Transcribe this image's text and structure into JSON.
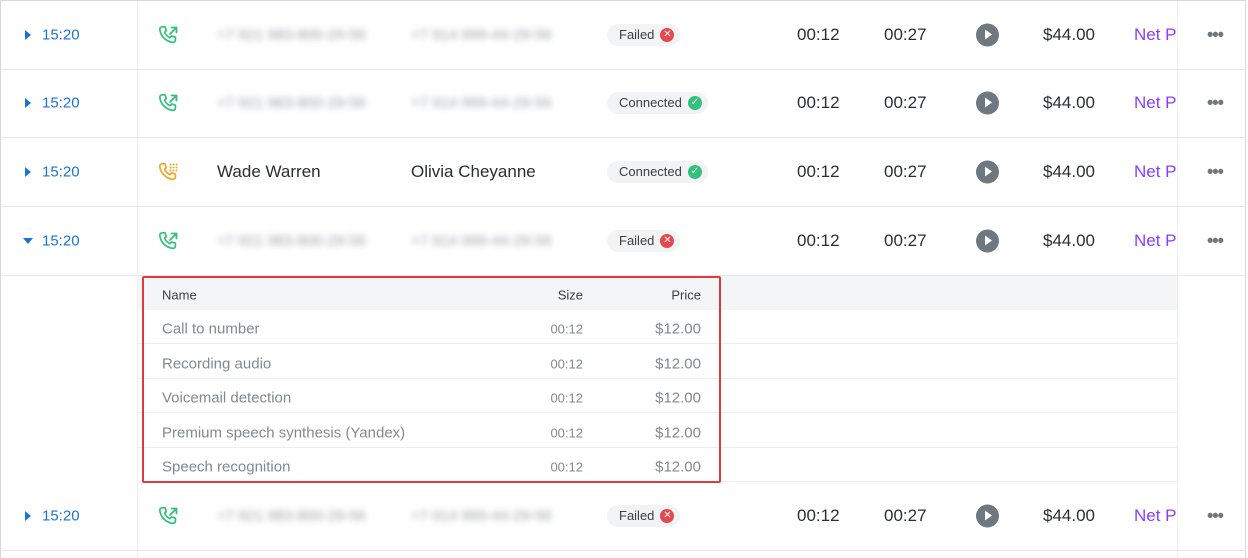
{
  "rows": [
    {
      "time": "15:20",
      "from": "+7 921 983-800-29-56",
      "to": "+7 914 999-44-29-56",
      "status": "Failed",
      "duration": "00:12",
      "billed": "00:27",
      "price": "$44.00",
      "tariff": "Net P",
      "expanded": false
    },
    {
      "time": "15:20",
      "from": "+7 921 983-800-29-56",
      "to": "+7 914 999-44-29-56",
      "status": "Connected",
      "duration": "00:12",
      "billed": "00:27",
      "price": "$44.00",
      "tariff": "Net P",
      "expanded": false
    },
    {
      "time": "15:20",
      "from": "Wade Warren",
      "to": "Olivia Cheyanne",
      "status": "Connected",
      "duration": "00:12",
      "billed": "00:27",
      "price": "$44.00",
      "tariff": "Net P",
      "expanded": false
    },
    {
      "time": "15:20",
      "from": "+7 921 983-800-29-56",
      "to": "+7 914 999-44-29-56",
      "status": "Failed",
      "duration": "00:12",
      "billed": "00:27",
      "price": "$44.00",
      "tariff": "Net P",
      "expanded": true
    },
    {
      "time": "15:20",
      "from": "+7 921 983-800-29-56",
      "to": "+7 914 999-44-29-56",
      "status": "Failed",
      "duration": "00:12",
      "billed": "00:27",
      "price": "$44.00",
      "tariff": "Net P",
      "expanded": false
    }
  ],
  "details": {
    "headers": {
      "name": "Name",
      "size": "Size",
      "price": "Price"
    },
    "items": [
      {
        "name": "Call to number",
        "size": "00:12",
        "price": "$12.00"
      },
      {
        "name": "Recording audio",
        "size": "00:12",
        "price": "$12.00"
      },
      {
        "name": "Voicemail detection",
        "size": "00:12",
        "price": "$12.00"
      },
      {
        "name": "Premium speech synthesis (Yandex)",
        "size": "00:12",
        "price": "$12.00"
      },
      {
        "name": "Speech recognition",
        "size": "00:12",
        "price": "$12.00"
      }
    ]
  },
  "icons": {
    "outgoing_call": "phone-outgoing-icon",
    "dialpad_call": "phone-dialpad-icon",
    "failed": "x-icon",
    "connected": "check-icon",
    "play": "play-icon",
    "more": "more-horizontal-icon"
  },
  "colors": {
    "link": "#1a73d9",
    "tariff": "#8b3dff",
    "failed": "#e5484d",
    "connected": "#34c17b",
    "outgoing_icon": "#34c17b",
    "dialpad_icon": "#f5a623",
    "highlight_border": "#e0393e"
  }
}
